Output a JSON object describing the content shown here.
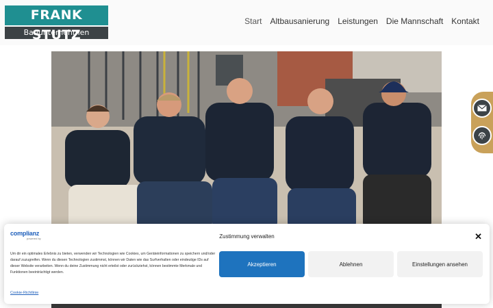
{
  "logo": {
    "line1": "FRANK STUTZ",
    "line2": "Bauunternehmen"
  },
  "nav": {
    "items": [
      {
        "label": "Start"
      },
      {
        "label": "Altbausanierung"
      },
      {
        "label": "Leistungen"
      },
      {
        "label": "Die Mannschaft"
      },
      {
        "label": "Kontakt"
      }
    ]
  },
  "hero": {
    "description": "team-photo"
  },
  "side": {
    "mail_icon": "mail-icon",
    "fingerprint_icon": "fingerprint-icon"
  },
  "consent": {
    "logo_main": "complianz",
    "logo_sub": "powered by",
    "title": "Zustimmung verwalten",
    "text": "Um dir ein optimales Erlebnis zu bieten, verwenden wir Technologien wie Cookies, um Geräteinformationen zu speichern und/oder darauf zuzugreifen. Wenn du diesen Technologien zustimmst, können wir Daten wie das Surfverhalten oder eindeutige IDs auf dieser Website verarbeiten. Wenn du deine Zustimmung nicht erteilst oder zurückziehst, können bestimmte Merkmale und Funktionen beeinträchtigt werden.",
    "accept_label": "Akzeptieren",
    "deny_label": "Ablehnen",
    "prefs_label": "Einstellungen ansehen",
    "policy_link": "Cookie-Richtlinie",
    "close_symbol": "✕"
  },
  "colors": {
    "brand_teal": "#1f8f91",
    "brand_dark": "#3c4245",
    "accent_gold": "#c9a15a",
    "accept_blue": "#1e73be"
  }
}
